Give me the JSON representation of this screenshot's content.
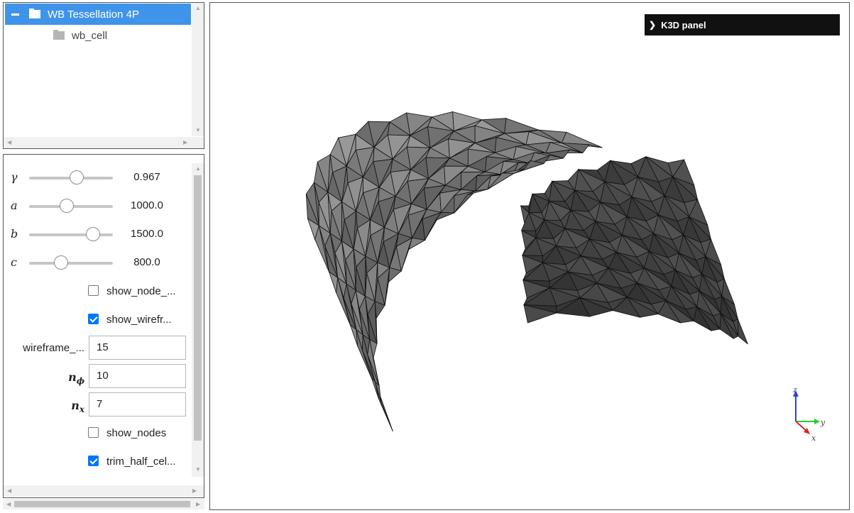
{
  "tree": {
    "items": [
      {
        "label": "WB Tessellation 4P",
        "selected": true,
        "expanded": true
      },
      {
        "label": "wb_cell",
        "selected": false
      }
    ]
  },
  "controls": {
    "sliders": [
      {
        "symbol": "γ",
        "value": "0.967",
        "fraction": 0.57
      },
      {
        "symbol": "a",
        "value": "1000.0",
        "fraction": 0.45
      },
      {
        "symbol": "b",
        "value": "1500.0",
        "fraction": 0.76
      },
      {
        "symbol": "c",
        "value": "800.0",
        "fraction": 0.38
      }
    ],
    "show_node_label": "show_node_...",
    "show_wireframe_label": "show_wirefr...",
    "wireframe_label": "wireframe_...",
    "wireframe_value": "15",
    "n_phi_label": "n",
    "n_phi_sub": "ϕ",
    "n_phi_value": "10",
    "n_x_label": "n",
    "n_x_sub": "x",
    "n_x_value": "7",
    "show_nodes_label": "show_nodes",
    "trim_half_label": "trim_half_cel..."
  },
  "viewer": {
    "panel_label": "K3D panel",
    "axis_labels": {
      "z": "z",
      "y": "y",
      "x": "x"
    }
  },
  "colors": {
    "selection": "#3f94ea",
    "checkbox_checked": "#0075ff",
    "mesh_light": "#8a8a8a",
    "mesh_dark": "#4d4d4d"
  }
}
